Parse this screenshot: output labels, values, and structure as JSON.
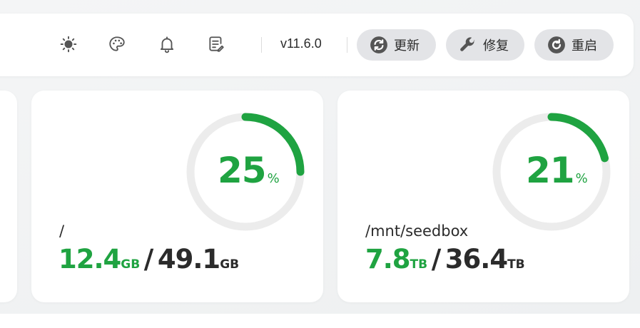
{
  "toolbar": {
    "icons": [
      "sun-icon",
      "palette-icon",
      "bell-icon",
      "notes-icon"
    ],
    "version": "v11.6.0",
    "buttons": [
      {
        "label": "更新",
        "icon": "refresh-icon"
      },
      {
        "label": "修复",
        "icon": "wrench-icon"
      },
      {
        "label": "重启",
        "icon": "restart-icon"
      }
    ]
  },
  "disks": [
    {
      "percent": "25",
      "percent_unit": "%",
      "fill_fraction": 0.25,
      "path": "/",
      "used_value": "12.4",
      "used_unit": "GB",
      "separator": "/",
      "total_value": "49.1",
      "total_unit": "GB"
    },
    {
      "percent": "21",
      "percent_unit": "%",
      "fill_fraction": 0.21,
      "path": "/mnt/seedbox",
      "used_value": "7.8",
      "used_unit": "TB",
      "separator": "/",
      "total_value": "36.4",
      "total_unit": "TB"
    }
  ],
  "colors": {
    "accent_green": "#1fa341",
    "ring_track": "#ececec",
    "button_bg": "#e3e4e7",
    "icon_gray": "#555555"
  }
}
